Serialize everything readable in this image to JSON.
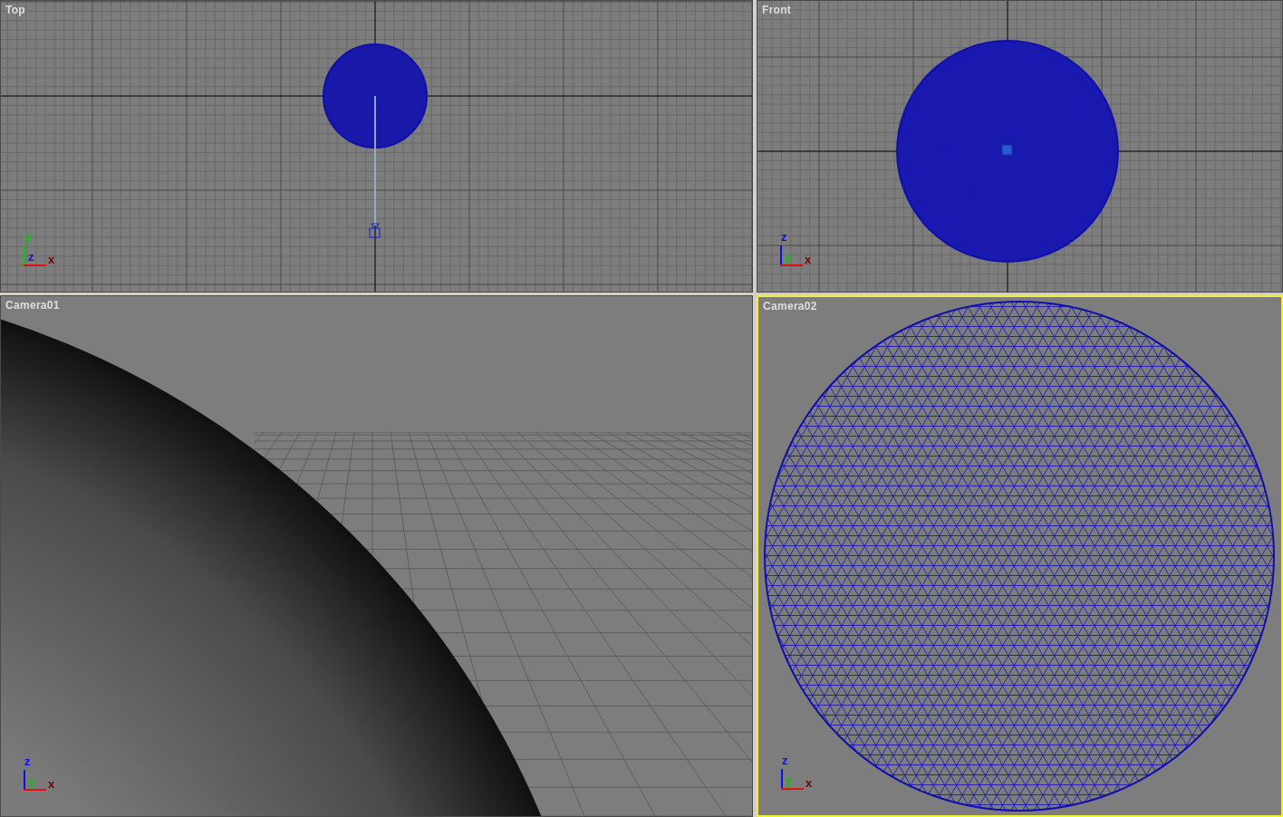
{
  "viewports": [
    {
      "label": "Top",
      "kind": "top",
      "selected": false,
      "axes": [
        {
          "kind": "up",
          "letter": "y",
          "color": "#10c010"
        },
        {
          "kind": "origin",
          "letter": "z",
          "color": "#1010e0"
        },
        {
          "kind": "right",
          "letter": "x",
          "color": "#e01010"
        }
      ]
    },
    {
      "label": "Front",
      "kind": "front",
      "selected": false,
      "axes": [
        {
          "kind": "up",
          "letter": "z",
          "color": "#1010e0"
        },
        {
          "kind": "origin",
          "letter": "y",
          "color": "#10c010"
        },
        {
          "kind": "right",
          "letter": "x",
          "color": "#e01010"
        }
      ]
    },
    {
      "label": "Camera01",
      "kind": "shaded",
      "selected": false,
      "axes": [
        {
          "kind": "up",
          "letter": "z",
          "color": "#1010e0"
        },
        {
          "kind": "origin",
          "letter": "y",
          "color": "#10c010"
        },
        {
          "kind": "right",
          "letter": "x",
          "color": "#e01010"
        }
      ]
    },
    {
      "label": "Camera02",
      "kind": "wire",
      "selected": true,
      "axes": [
        {
          "kind": "up",
          "letter": "z",
          "color": "#1010e0"
        },
        {
          "kind": "origin",
          "letter": "y",
          "color": "#10c010"
        },
        {
          "kind": "right",
          "letter": "x",
          "color": "#e01010"
        }
      ]
    }
  ]
}
